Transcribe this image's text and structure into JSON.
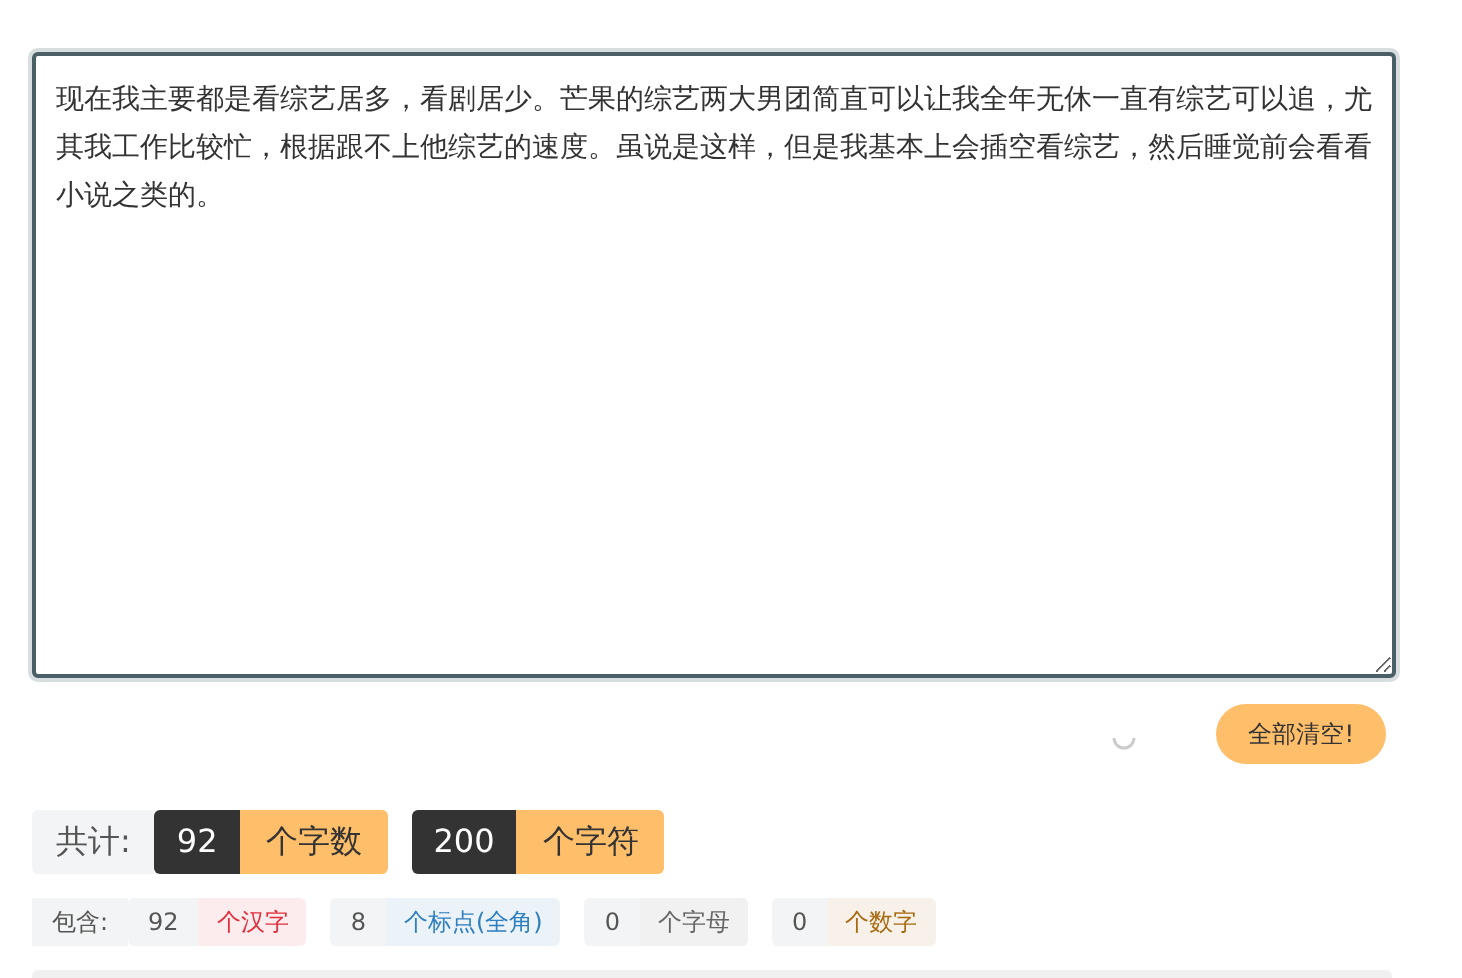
{
  "editor": {
    "value": "现在我主要都是看综艺居多，看剧居少。芒果的综艺两大男团简直可以让我全年无休一直有综艺可以追，尤其我工作比较忙，根据跟不上他综艺的速度。虽说是这样，但是我基本上会插空看综艺，然后睡觉前会看看小说之类的。"
  },
  "clear_button": "全部清空!",
  "totals": {
    "label": "共计:",
    "items": [
      {
        "count": "92",
        "unit": "个字数"
      },
      {
        "count": "200",
        "unit": "个字符"
      }
    ]
  },
  "details": {
    "label": "包含:",
    "items": [
      {
        "count": "92",
        "unit": "个汉字",
        "color": "#e0303f"
      },
      {
        "count": "8",
        "unit": "个标点(全角)",
        "color": "#2f7fc0"
      },
      {
        "count": "0",
        "unit": "个字母",
        "color": "#666666"
      },
      {
        "count": "0",
        "unit": "个数字",
        "color": "#a86a10"
      }
    ]
  }
}
